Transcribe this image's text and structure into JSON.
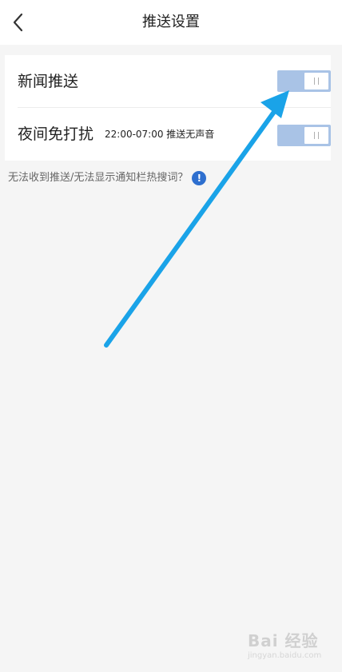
{
  "header": {
    "title": "推送设置",
    "back_icon": "chevron-left-icon"
  },
  "settings": [
    {
      "label": "新闻推送",
      "sublabel": "",
      "toggle_on": false
    },
    {
      "label": "夜间免打扰",
      "sublabel": "22:00-07:00 推送无声音",
      "toggle_on": false
    }
  ],
  "help": {
    "text": "无法收到推送/无法显示通知栏热搜词？",
    "icon": "info-icon",
    "icon_glyph": "!"
  },
  "watermark": {
    "main": "Bai 经验",
    "sub": "jingyan.baidu.com"
  },
  "colors": {
    "toggle_track": "#a9c3e6",
    "arrow": "#1aa3e8",
    "help_icon": "#2e6fcf",
    "background": "#f5f5f5"
  }
}
